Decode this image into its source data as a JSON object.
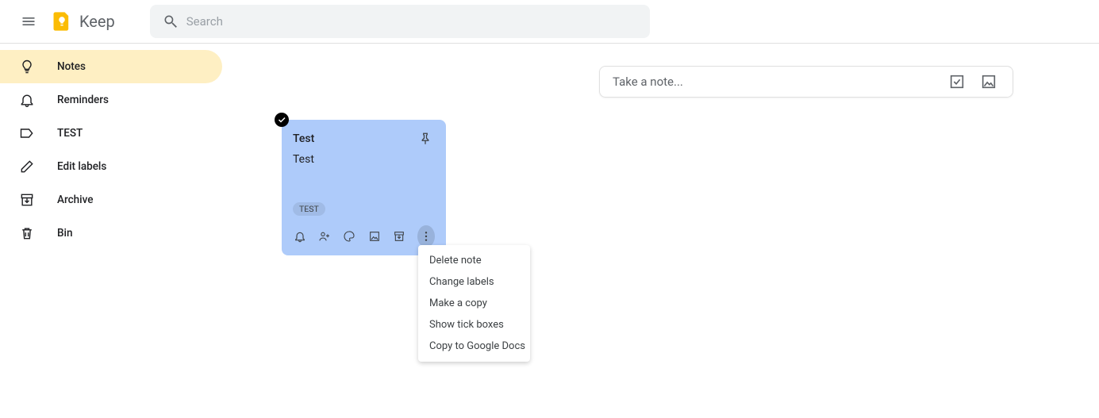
{
  "header": {
    "app_title": "Keep",
    "search_placeholder": "Search"
  },
  "sidebar": {
    "items": [
      {
        "label": "Notes",
        "icon": "lightbulb",
        "active": true
      },
      {
        "label": "Reminders",
        "icon": "bell",
        "active": false
      },
      {
        "label": "TEST",
        "icon": "label",
        "active": false
      },
      {
        "label": "Edit labels",
        "icon": "pencil",
        "active": false
      },
      {
        "label": "Archive",
        "icon": "archive",
        "active": false
      },
      {
        "label": "Bin",
        "icon": "trash",
        "active": false
      }
    ]
  },
  "take_note": {
    "placeholder": "Take a note..."
  },
  "note": {
    "title": "Test",
    "body": "Test",
    "label": "TEST",
    "color": "#aecbfa",
    "selected": true
  },
  "menu": {
    "items": [
      "Delete note",
      "Change labels",
      "Make a copy",
      "Show tick boxes",
      "Copy to Google Docs"
    ]
  }
}
